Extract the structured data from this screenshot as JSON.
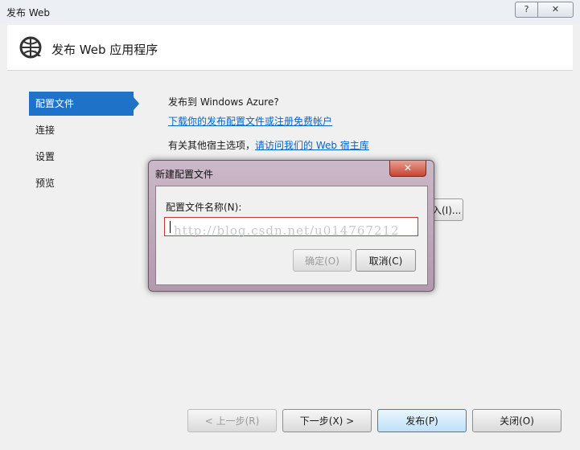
{
  "window": {
    "title": "发布 Web",
    "help_label": "?",
    "close_label": "✕"
  },
  "header": {
    "title": "发布 Web 应用程序",
    "icon": "globe-icon"
  },
  "nav": {
    "items": [
      {
        "label": "配置文件",
        "active": true
      },
      {
        "label": "连接"
      },
      {
        "label": "设置"
      },
      {
        "label": "预览"
      }
    ]
  },
  "main": {
    "azure_question": "发布到 Windows Azure?",
    "download_link": "下载你的发布配置文件或注册免费帐户",
    "other_host_prefix": "有关其他宿主选项，",
    "other_host_link": "请访问我们的 Web 宿主库",
    "import_button_partial": "入(I)..."
  },
  "dialog": {
    "title": "新建配置文件",
    "close_label": "✕",
    "field_label": "配置文件名称(N):",
    "field_value": "",
    "watermark": "http://blog.csdn.net/u014767212",
    "ok_label": "确定(O)",
    "cancel_label": "取消(C)"
  },
  "footer": {
    "prev_label": "< 上一步(R)",
    "next_label": "下一步(X) >",
    "publish_label": "发布(P)",
    "close_label": "关闭(O)"
  }
}
